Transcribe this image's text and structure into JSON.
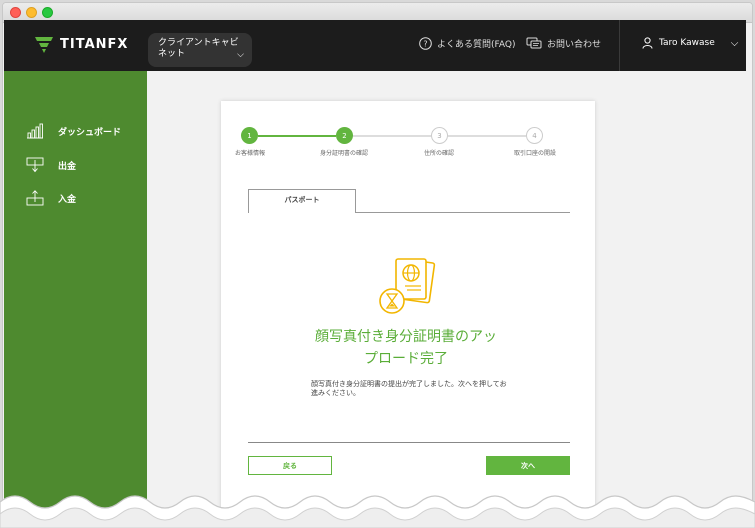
{
  "brand": {
    "logo_text": "TITANFX"
  },
  "topbar": {
    "cabinet_label": "クライアントキャビネット",
    "faq_label": "よくある質問(FAQ)",
    "contact_label": "お問い合わせ",
    "user_name": "Taro Kawase"
  },
  "sidebar": {
    "items": [
      {
        "label": "ダッシュボード",
        "icon": "bar-chart-icon"
      },
      {
        "label": "出金",
        "icon": "withdraw-icon"
      },
      {
        "label": "入金",
        "icon": "deposit-icon"
      }
    ]
  },
  "steps": [
    {
      "number": "1",
      "label": "お客様情報",
      "state": "done"
    },
    {
      "number": "2",
      "label": "身分証明書の確認",
      "state": "done"
    },
    {
      "number": "3",
      "label": "住所の確認",
      "state": "todo"
    },
    {
      "number": "4",
      "label": "取引口座の開設",
      "state": "todo"
    }
  ],
  "tab": {
    "label": "パスポート"
  },
  "main": {
    "headline_line1": "顔写真付き身分証明書のアッ",
    "headline_line2": "プロード完了",
    "description": "顔写真付き身分証明書の提出が完了しました。次へを押してお進みください。"
  },
  "buttons": {
    "back_label": "戻る",
    "next_label": "次へ"
  },
  "colors": {
    "accent": "#62b53f",
    "sidebar": "#4e8a2f",
    "topbar": "#1c1c1c",
    "illustration": "#f2b600"
  }
}
